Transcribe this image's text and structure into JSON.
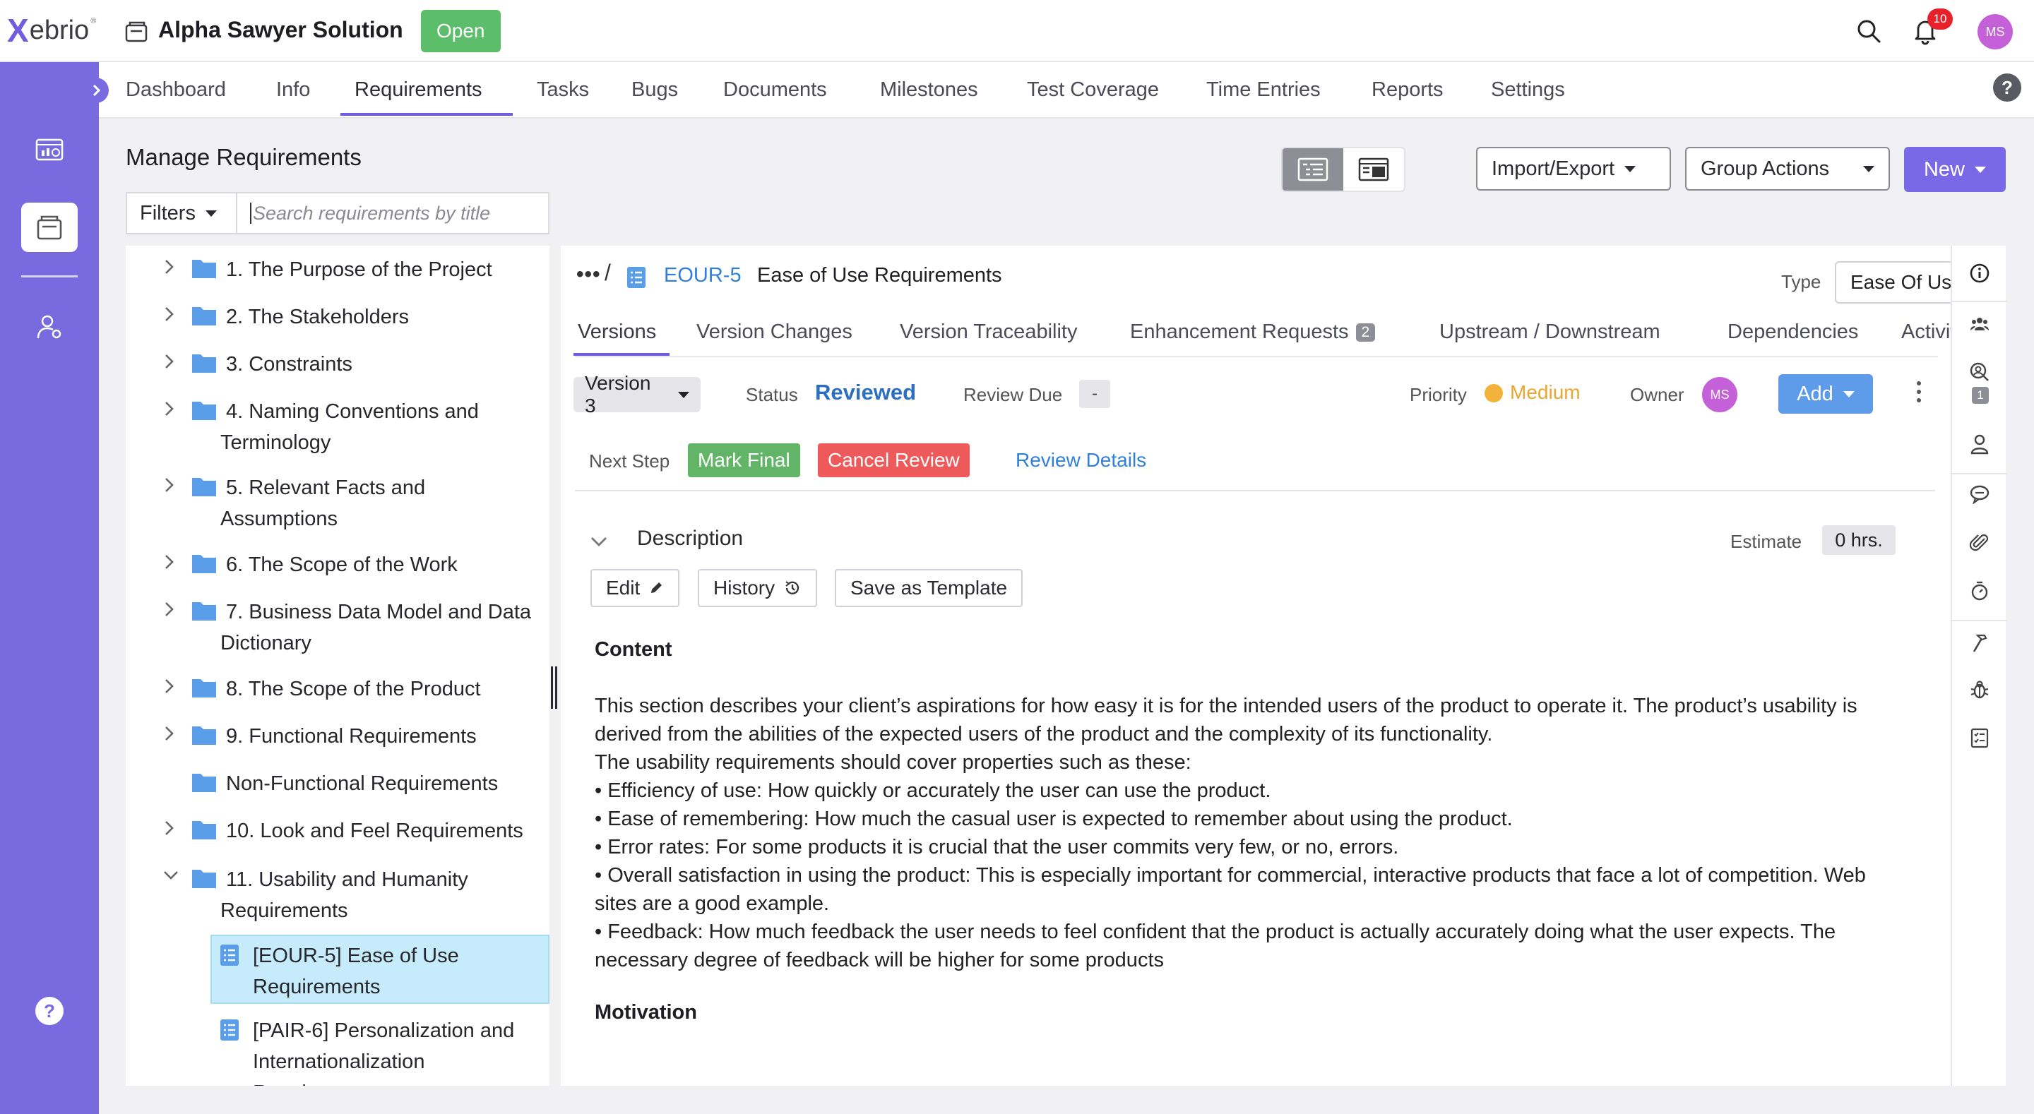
{
  "app": {
    "logo_x": "X",
    "logo_rest": "ebrio",
    "logo_tm": "®"
  },
  "header": {
    "project_title": "Alpha Sawyer Solution",
    "project_status": "Open",
    "notification_count": "10",
    "user_initials": "MS"
  },
  "nav": {
    "tabs": [
      {
        "label": "Dashboard"
      },
      {
        "label": "Info"
      },
      {
        "label": "Requirements"
      },
      {
        "label": "Tasks"
      },
      {
        "label": "Bugs"
      },
      {
        "label": "Documents"
      },
      {
        "label": "Milestones"
      },
      {
        "label": "Test Coverage"
      },
      {
        "label": "Time Entries"
      },
      {
        "label": "Reports"
      },
      {
        "label": "Settings"
      }
    ],
    "active": "Requirements",
    "help": "?"
  },
  "page": {
    "title": "Manage Requirements",
    "import_export": "Import/Export",
    "group_actions": "Group Actions",
    "new": "New",
    "filters": "Filters",
    "search_placeholder": "Search requirements by title"
  },
  "tree": {
    "items": [
      {
        "lines": [
          "1. The Purpose of the Project"
        ]
      },
      {
        "lines": [
          "2. The Stakeholders"
        ]
      },
      {
        "lines": [
          "3. Constraints"
        ]
      },
      {
        "lines": [
          "4. Naming Conventions and",
          "Terminology"
        ]
      },
      {
        "lines": [
          "5. Relevant Facts and",
          "Assumptions"
        ]
      },
      {
        "lines": [
          "6. The Scope of the Work"
        ]
      },
      {
        "lines": [
          "7. Business Data Model and Data",
          "Dictionary"
        ]
      },
      {
        "lines": [
          "8. The Scope of the Product"
        ]
      },
      {
        "lines": [
          "9. Functional Requirements"
        ]
      },
      {
        "lines": [
          "Non-Functional Requirements"
        ]
      },
      {
        "lines": [
          "10. Look and Feel Requirements"
        ]
      },
      {
        "lines": [
          "11. Usability and Humanity",
          "Requirements"
        ]
      }
    ],
    "requirements": [
      {
        "lines": [
          "[EOUR-5]  Ease of Use",
          "Requirements"
        ]
      },
      {
        "lines": [
          "[PAIR-6]  Personalization and",
          "Internationalization",
          "Requirements"
        ]
      }
    ]
  },
  "detail": {
    "breadcrumb_dots": "•••",
    "breadcrumb_slash": "/",
    "code": "EOUR-5",
    "title": "Ease of Use Requirements",
    "type_label": "Type",
    "type_value": "Ease Of Use",
    "tabs": [
      {
        "label": "Versions"
      },
      {
        "label": "Version Changes"
      },
      {
        "label": "Version Traceability"
      },
      {
        "label": "Enhancement Requests",
        "count": "2"
      },
      {
        "label": "Upstream / Downstream"
      },
      {
        "label": "Dependencies"
      },
      {
        "label": "Activity"
      }
    ],
    "version": "Version 3",
    "status_label": "Status",
    "status_value": "Reviewed",
    "review_due_label": "Review Due",
    "review_due_value": "-",
    "priority_label": "Priority",
    "priority_value": "Medium",
    "owner_label": "Owner",
    "owner_initials": "MS",
    "add": "Add",
    "next_step_label": "Next Step",
    "mark_final": "Mark Final",
    "cancel_review": "Cancel Review",
    "review_details": "Review Details",
    "description_title": "Description",
    "estimate_label": "Estimate",
    "estimate_value": "0 hrs.",
    "edit": "Edit",
    "history": "History",
    "save_template": "Save as Template",
    "content_heading": "Content",
    "content_lines": [
      "This section describes your client’s aspirations for how easy it is for the intended users of the product to operate it. The product’s usability is derived from the abilities of the expected users of the product and the complexity of its functionality.",
      "The usability requirements should cover properties such as these:",
      "• Efficiency of use: How quickly or accurately the user can use the product.",
      "• Ease of remembering: How much the casual user is expected to remember about using the product.",
      "• Error rates: For some products it is crucial that the user commits very few, or no, errors.",
      "• Overall satisfaction in using the product: This is especially important for commercial, interactive products that face a lot of competition. Web sites are a good example.",
      "• Feedback: How much feedback the user needs to feel confident that the product is actually accurately doing what the user expects. The necessary degree of feedback will be higher for some products"
    ],
    "motivation_heading": "Motivation"
  },
  "right_rail": {
    "reviewer_count": "1"
  },
  "colors": {
    "brand": "#7a6ae0",
    "accent_blue": "#2f7fdc",
    "status_open": "#5cbd6b",
    "mark_final": "#62b467",
    "cancel_review": "#ee5a5a",
    "priority_medium": "#e8a733",
    "avatar": "#c561d8"
  }
}
